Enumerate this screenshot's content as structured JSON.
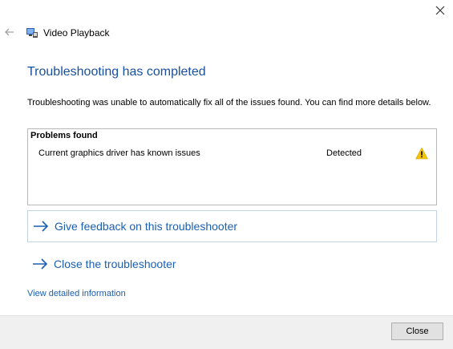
{
  "window": {
    "title": "Video Playback",
    "close_glyph": "✕"
  },
  "content": {
    "heading": "Troubleshooting has completed",
    "description": "Troubleshooting was unable to automatically fix all of the issues found. You can find more details below.",
    "problems": {
      "header": "Problems found",
      "items": [
        {
          "label": "Current graphics driver has known issues",
          "status": "Detected",
          "icon": "warning-icon"
        }
      ]
    },
    "options": {
      "feedback": "Give feedback on this troubleshooter",
      "close": "Close the troubleshooter"
    },
    "detail_link": "View detailed information"
  },
  "footer": {
    "close_label": "Close"
  },
  "colors": {
    "heading": "#1a4f9c",
    "link": "#1a5fb0",
    "warning": "#f5c400"
  }
}
